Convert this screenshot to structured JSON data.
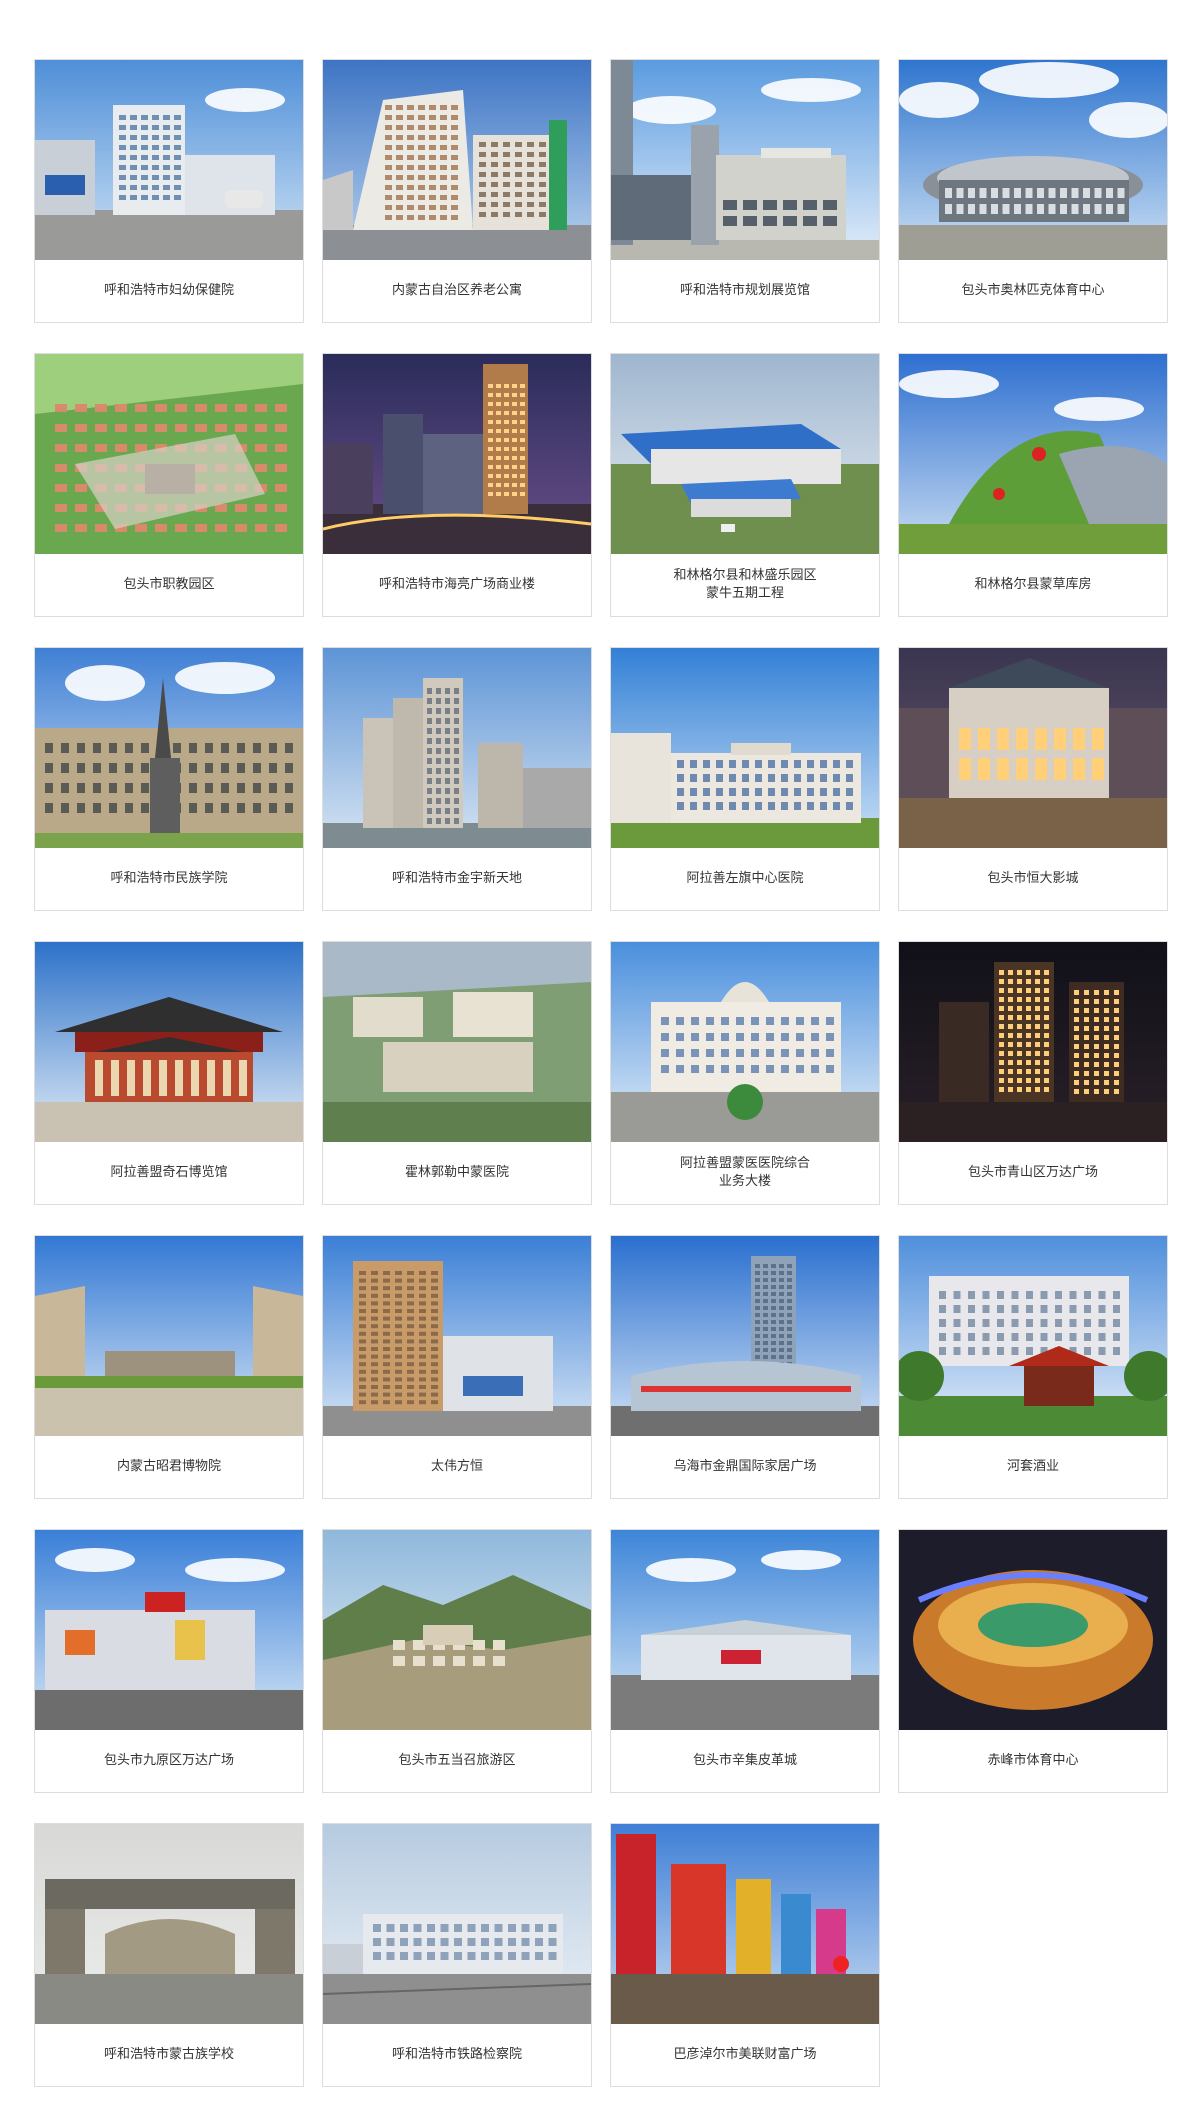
{
  "projects": [
    {
      "title": "呼和浩特市妇幼保健院",
      "scene": "hospital"
    },
    {
      "title": "内蒙古自治区养老公寓",
      "scene": "apartment"
    },
    {
      "title": "呼和浩特市规划展览馆",
      "scene": "gallery"
    },
    {
      "title": "包头市奥林匹克体育中心",
      "scene": "stadium"
    },
    {
      "title": "包头市职教园区",
      "scene": "aerial"
    },
    {
      "title": "呼和浩特市海亮广场商业楼",
      "scene": "night-tower"
    },
    {
      "title": "和林格尔县和林盛乐园区\n蒙牛五期工程",
      "scene": "factory"
    },
    {
      "title": "和林格尔县蒙草库房",
      "scene": "green-roof"
    },
    {
      "title": "呼和浩特市民族学院",
      "scene": "statue"
    },
    {
      "title": "呼和浩特市金宇新天地",
      "scene": "towers"
    },
    {
      "title": "阿拉善左旗中心医院",
      "scene": "hospital-wide"
    },
    {
      "title": "包头市恒大影城",
      "scene": "cinema"
    },
    {
      "title": "阿拉善盟奇石博览馆",
      "scene": "museum-roof"
    },
    {
      "title": "霍林郭勒中蒙医院",
      "scene": "aerial-hospital"
    },
    {
      "title": "阿拉善盟蒙医医院综合\n业务大楼",
      "scene": "mongol-hospital"
    },
    {
      "title": "包头市青山区万达广场",
      "scene": "night-towers"
    },
    {
      "title": "内蒙古昭君博物院",
      "scene": "gate"
    },
    {
      "title": "太伟方恒",
      "scene": "hotel"
    },
    {
      "title": "乌海市金鼎国际家居广场",
      "scene": "mall-tower"
    },
    {
      "title": "河套酒业",
      "scene": "pavilion"
    },
    {
      "title": "包头市九原区万达广场",
      "scene": "mall"
    },
    {
      "title": "包头市五当召旅游区",
      "scene": "mountain"
    },
    {
      "title": "包头市辛集皮革城",
      "scene": "leather-city"
    },
    {
      "title": "赤峰市体育中心",
      "scene": "night-stadium"
    },
    {
      "title": "呼和浩特市蒙古族学校",
      "scene": "school-gate"
    },
    {
      "title": "呼和浩特市铁路检察院",
      "scene": "procuratorate"
    },
    {
      "title": "巴彦淖尔市美联财富广场",
      "scene": "signs"
    }
  ]
}
